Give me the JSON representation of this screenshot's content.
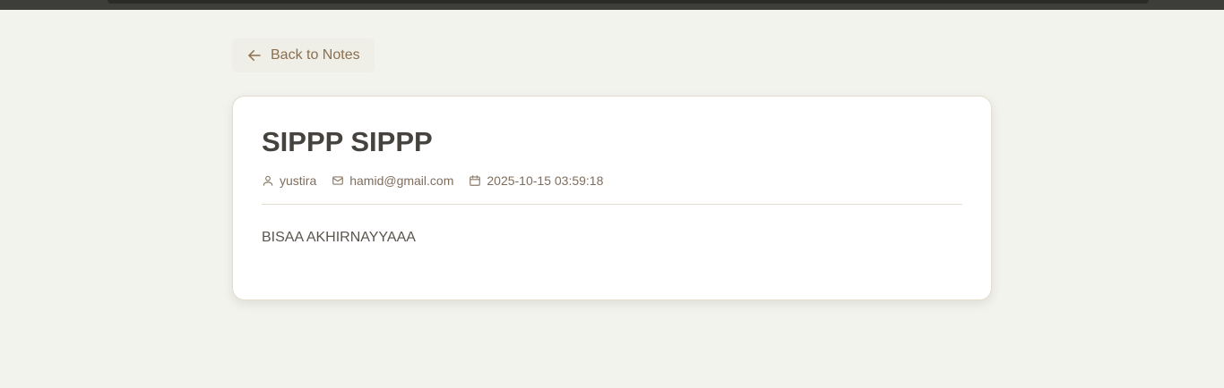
{
  "back_button": {
    "label": "Back to Notes",
    "icon": "arrow-left-icon"
  },
  "note": {
    "title": "SIPPP SIPPP",
    "author": "yustira",
    "email": "hamid@gmail.com",
    "timestamp": "2025-10-15 03:59:18",
    "body": "BISAA AKHIRNAYYAAA"
  },
  "icons": {
    "author": "user-icon",
    "email": "mail-icon",
    "timestamp": "calendar-icon"
  },
  "colors": {
    "background": "#f3f3ee",
    "accent": "#8b6f4f",
    "title": "#46433f",
    "card": "#ffffff"
  }
}
